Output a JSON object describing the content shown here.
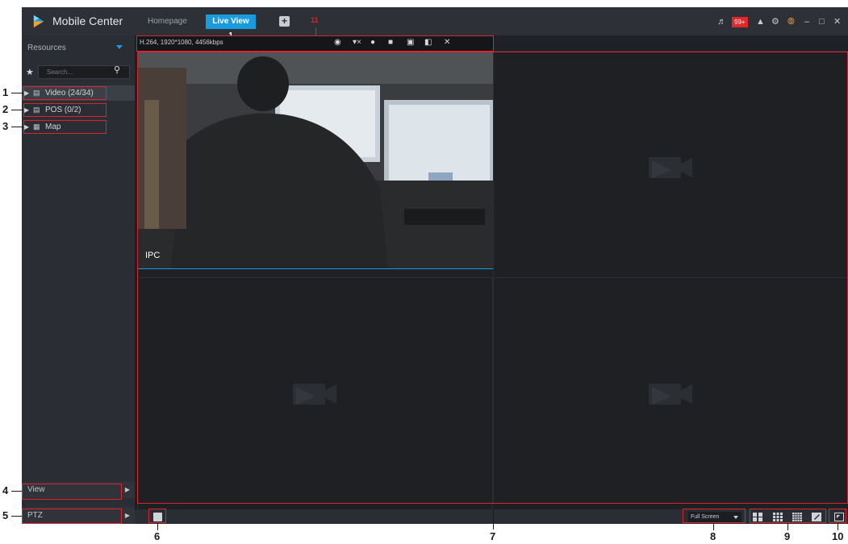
{
  "app": {
    "title": "Mobile Center"
  },
  "tabs": {
    "home": "Homepage",
    "live": "Live View 1"
  },
  "title_bar": {
    "badge": "99+",
    "minimize": "–",
    "restore": "□",
    "close": "✕"
  },
  "sidebar": {
    "header": "Resources",
    "search_placeholder": "Search...",
    "items": [
      {
        "label": "Video (24/34)"
      },
      {
        "label": "POS (0/2)"
      },
      {
        "label": "Map"
      }
    ],
    "view_label": "View",
    "ptz_label": "PTZ"
  },
  "video": {
    "stream_info": "H.264, 1920*1080, 4456kbps",
    "overlay_label": "IPC"
  },
  "bottom": {
    "display_mode": "Full Screen"
  },
  "annotations": {
    "n1": "1",
    "n2": "2",
    "n3": "3",
    "n4": "4",
    "n5": "5",
    "n6": "6",
    "n7": "7",
    "n8": "8",
    "n9": "9",
    "n10": "10",
    "n11": "11"
  },
  "colors": {
    "accent": "#1a9bde",
    "annotation": "#d9252b",
    "badge": "#e0272b"
  }
}
